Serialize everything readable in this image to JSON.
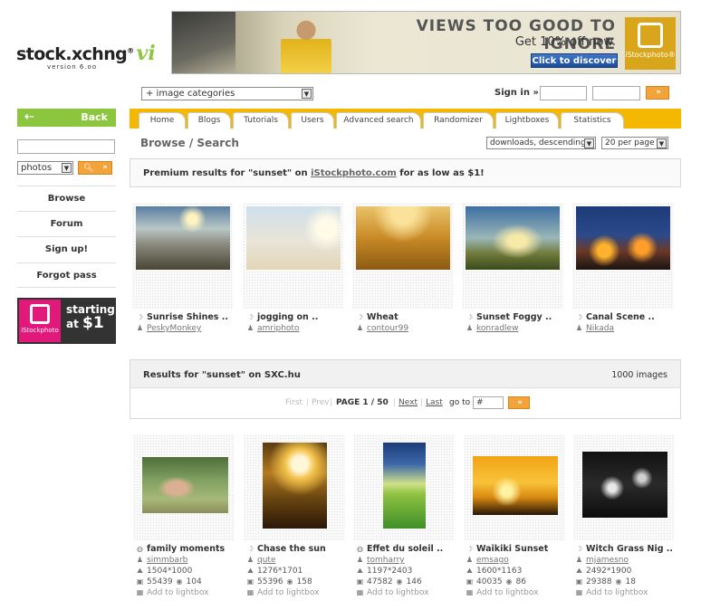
{
  "header": {
    "logo_text": "stock.xchng",
    "logo_mark": "®",
    "logo_vi": "vi",
    "version": "version 6.oo",
    "banner": {
      "headline": "VIEWS TOO GOOD TO IGNORE",
      "subline": "Get 10% off now.",
      "cta": "Click to discover",
      "brand": "iStockphoto®"
    }
  },
  "topbar": {
    "category_select": "+ image categories",
    "signin_label": "Sign in »",
    "signin_go": "»"
  },
  "sidebar": {
    "back_label": "Back",
    "back_arrow": "⇠",
    "search_type": "photos",
    "links": [
      "Browse",
      "Forum",
      "Sign up!",
      "Forgot pass"
    ],
    "ad": {
      "brand": "iStockphoto",
      "line1": "starting",
      "line2": "at",
      "price": "$1"
    }
  },
  "tabs": [
    "Home",
    "Blogs",
    "Tutorials",
    "Users",
    "Advanced search",
    "Randomizer",
    "Lightboxes",
    "Statistics"
  ],
  "browse": {
    "title": "Browse / Search",
    "sort": "downloads, descending",
    "per_page": "20 per page"
  },
  "premium": {
    "prefix": "Premium results for \"sunset\" on ",
    "link": "iStockphoto.com",
    "suffix": " for as low as $1!",
    "items": [
      {
        "title": "Sunrise Shines ..",
        "user": "PeskyMonkey"
      },
      {
        "title": "jogging on ..",
        "user": "amriphoto"
      },
      {
        "title": "Wheat",
        "user": "contour99"
      },
      {
        "title": "Sunset Foggy ..",
        "user": "konradlew"
      },
      {
        "title": "Canal Scene ..",
        "user": "Nikada"
      }
    ]
  },
  "results": {
    "title": "Results for \"sunset\" on SXC.hu",
    "count": "1000 images",
    "pager": {
      "first": "First",
      "prev": "Prev",
      "page": "PAGE 1 / 50",
      "next": "Next",
      "last": "Last",
      "goto": "go to",
      "goto_value": "#"
    },
    "items": [
      {
        "title": "family moments",
        "user": "simmbarb",
        "size": "1504*1000",
        "downloads": "55439",
        "views": "104",
        "add": "Add to lightbox"
      },
      {
        "title": "Chase the sun",
        "user": "qute",
        "size": "1276*1701",
        "downloads": "55396",
        "views": "158",
        "add": "Add to lightbox"
      },
      {
        "title": "Effet du soleil ..",
        "user": "tomharry",
        "size": "1197*2403",
        "downloads": "47582",
        "views": "146",
        "add": "Add to lightbox"
      },
      {
        "title": "Waikiki Sunset",
        "user": "emsago",
        "size": "1600*1163",
        "downloads": "40035",
        "views": "86",
        "add": "Add to lightbox"
      },
      {
        "title": "Witch Grass Nig ..",
        "user": "mjamesno",
        "size": "2492*1900",
        "downloads": "29388",
        "views": "18",
        "add": "Add to lightbox"
      }
    ]
  }
}
